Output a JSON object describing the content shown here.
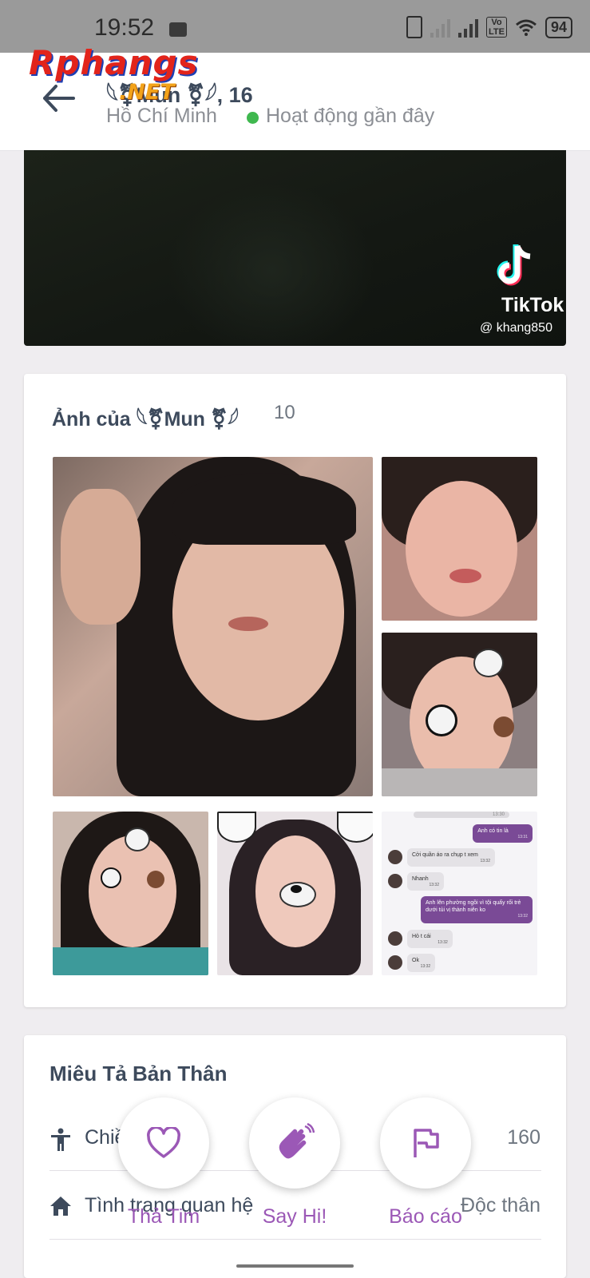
{
  "status_bar": {
    "time": "19:52",
    "battery": "94",
    "network_badge_top": "Vo",
    "network_badge_bottom": "LTE"
  },
  "header": {
    "name": "𓆩⚧Mun ⚧𓆪, 16",
    "city": "Hồ Chí Minh",
    "online_status": "Hoạt động gần đây",
    "online_color": "#3fb84f"
  },
  "watermark": {
    "brand": "Rphangs",
    "suffix": ".NET"
  },
  "video": {
    "brand": "TikTok",
    "username": "@ khang850"
  },
  "photos": {
    "title": "Ảnh của 𓆩⚧Mun ⚧𓆪",
    "count": "10",
    "chat_screenshot": {
      "messages": [
        {
          "side": "right",
          "text": "Anh có tin là",
          "time": "13:31"
        },
        {
          "side": "left",
          "text": "Cởi quần áo ra chụp t xem",
          "time": "13:32"
        },
        {
          "side": "left",
          "text": "Nhanh",
          "time": "13:32"
        },
        {
          "side": "right",
          "text": "Anh lên phường ngồi vì tội quấy rối trẻ dưới tủi vị thành niên ko",
          "time": "13:32"
        },
        {
          "side": "left",
          "text": "Hỏ t cái",
          "time": "13:32"
        },
        {
          "side": "left",
          "text": "Ok",
          "time": "13:32"
        }
      ],
      "top_time": "13:30"
    }
  },
  "description": {
    "title": "Miêu Tả Bản Thân",
    "rows": [
      {
        "icon": "person-icon",
        "label": "Chiều cao",
        "value": "160"
      },
      {
        "icon": "home-icon",
        "label": "Tình trạng quan hệ",
        "value": "Độc thân"
      }
    ]
  },
  "actions": {
    "like": "Thả Tim",
    "say_hi": "Say Hi!",
    "report": "Báo cáo",
    "accent_color": "#9b58b6"
  }
}
